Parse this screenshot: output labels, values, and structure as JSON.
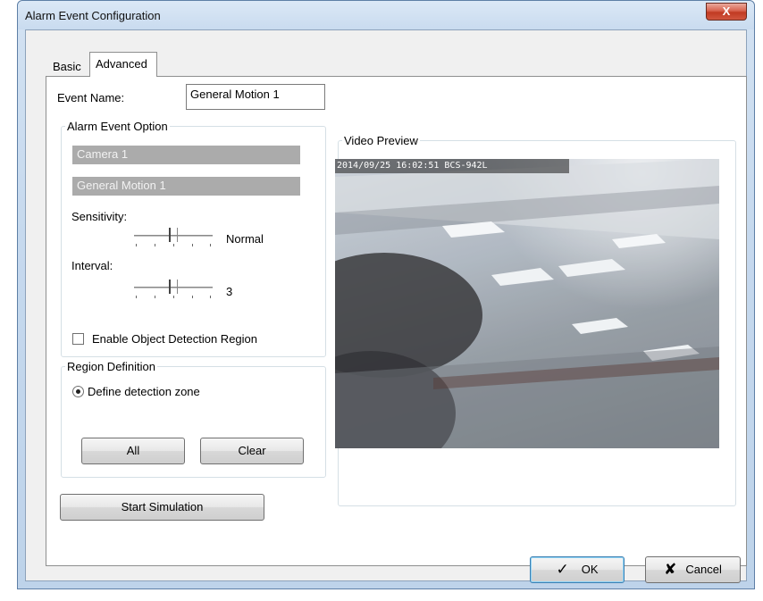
{
  "window": {
    "title": "Alarm Event Configuration",
    "close_glyph": "X"
  },
  "tabs": [
    {
      "label": "Basic",
      "selected": false
    },
    {
      "label": "Advanced",
      "selected": true
    }
  ],
  "event_name": {
    "label": "Event Name:",
    "value": "General Motion 1"
  },
  "alarm_event_option": {
    "legend": "Alarm Event Option",
    "camera": "Camera 1",
    "event": "General Motion 1",
    "sensitivity": {
      "label": "Sensitivity:",
      "value_label": "Normal",
      "level": 0.5
    },
    "interval": {
      "label": "Interval:",
      "value_label": "3",
      "level": 0.5
    },
    "enable_region": {
      "label": "Enable Object Detection Region",
      "checked": false
    }
  },
  "region_definition": {
    "legend": "Region Definition",
    "radio_label": "Define detection zone",
    "radio_selected": true,
    "all_label": "All",
    "clear_label": "Clear"
  },
  "start_simulation_label": "Start Simulation",
  "video_preview": {
    "legend": "Video Preview",
    "osd_text": "2014/09/25 16:02:51 BCS-942L"
  },
  "footer": {
    "ok_label": "OK",
    "ok_icon": "checkmark-icon",
    "cancel_label": "Cancel",
    "cancel_icon": "x-icon"
  },
  "colors": {
    "disabled_field_bg": "#ababab",
    "ok_focus_border": "#3c7fb1",
    "close_button": "#c13a22"
  }
}
